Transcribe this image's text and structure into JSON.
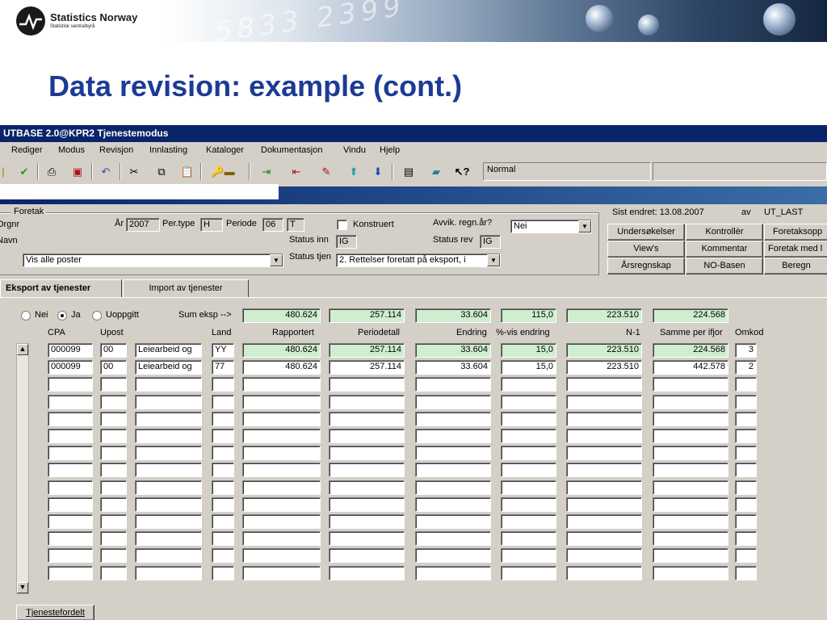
{
  "slide": {
    "title": "Data revision: example (cont.)",
    "logo_name": "Statistics Norway",
    "logo_sub": "Statistisk sentralbyrå"
  },
  "app": {
    "window_title": "UTBASE 2.0@KPR2 Tjenestemodus",
    "menu": [
      "Rediger",
      "Modus",
      "Revisjon",
      "Innlasting",
      "Kataloger",
      "Dokumentasjon",
      "Vindu",
      "Hjelp"
    ],
    "toolbar_status": "Normal",
    "foretak": {
      "group_label": "Foretak",
      "orgnr_label": "Orgnr",
      "navn_label": "Navn",
      "aar_label": "År",
      "aar_value": "2007",
      "pertype_label": "Per.type",
      "pertype_value": "H",
      "periode_label": "Periode",
      "periode_value": "06",
      "t_value": "T",
      "konstruert_label": "Konstruert",
      "avvik_label": "Avvik. regn.år?",
      "avvik_value": "Nei",
      "status_inn_label": "Status inn",
      "status_inn_value": "IG",
      "status_rev_label": "Status rev",
      "status_rev_value": "IG",
      "vis_value": "Vis alle poster",
      "status_tjen_label": "Status tjen",
      "status_tjen_value": "2. Rettelser foretatt på eksport, i"
    },
    "info": {
      "sist_endret": "Sist endret: 13.08.2007",
      "av_label": "av",
      "av_value": "UT_LAST"
    },
    "buttons": {
      "undersokelser": "Undersøkelser",
      "kontroller": "Kontrollèr",
      "foretaksopp": "Foretaksopp",
      "views": "View's",
      "kommentar": "Kommentar",
      "foretak_med": "Foretak med l",
      "arsregnskap": "Årsregnskap",
      "no_basen": "NO-Basen",
      "beregn": "Beregn",
      "tjenestefordelt": "Tjenestefordelt"
    },
    "tabs": [
      "Eksport av tjenester",
      "Import av tjenester"
    ],
    "radios": {
      "nei": "Nei",
      "ja": "Ja",
      "uoppgitt": "Uoppgitt",
      "selected": "Ja"
    },
    "sum_label": "Sum eksp -->",
    "sum_values": [
      "480.624",
      "257.114",
      "33.604",
      "115,0",
      "223.510",
      "224.568"
    ],
    "columns": [
      "CPA",
      "Upost",
      "Land",
      "Rapportert",
      "Periodetall",
      "Endring",
      "%-vis endring",
      "N-1",
      "Samme per ifjor",
      "Omkod"
    ],
    "rows": [
      {
        "cpa": "000099",
        "upost": "00",
        "desc": "Leiearbeid og",
        "land": "YY",
        "rapportert": "480.624",
        "periodetall": "257.114",
        "endring": "33.604",
        "pct": "15,0",
        "n1": "223.510",
        "samme": "224.568",
        "omkod": "3"
      },
      {
        "cpa": "000099",
        "upost": "00",
        "desc": "Leiearbeid og",
        "land": "77",
        "rapportert": "480.624",
        "periodetall": "257.114",
        "endring": "33.604",
        "pct": "15,0",
        "n1": "223.510",
        "samme": "442.578",
        "omkod": "2"
      }
    ]
  }
}
